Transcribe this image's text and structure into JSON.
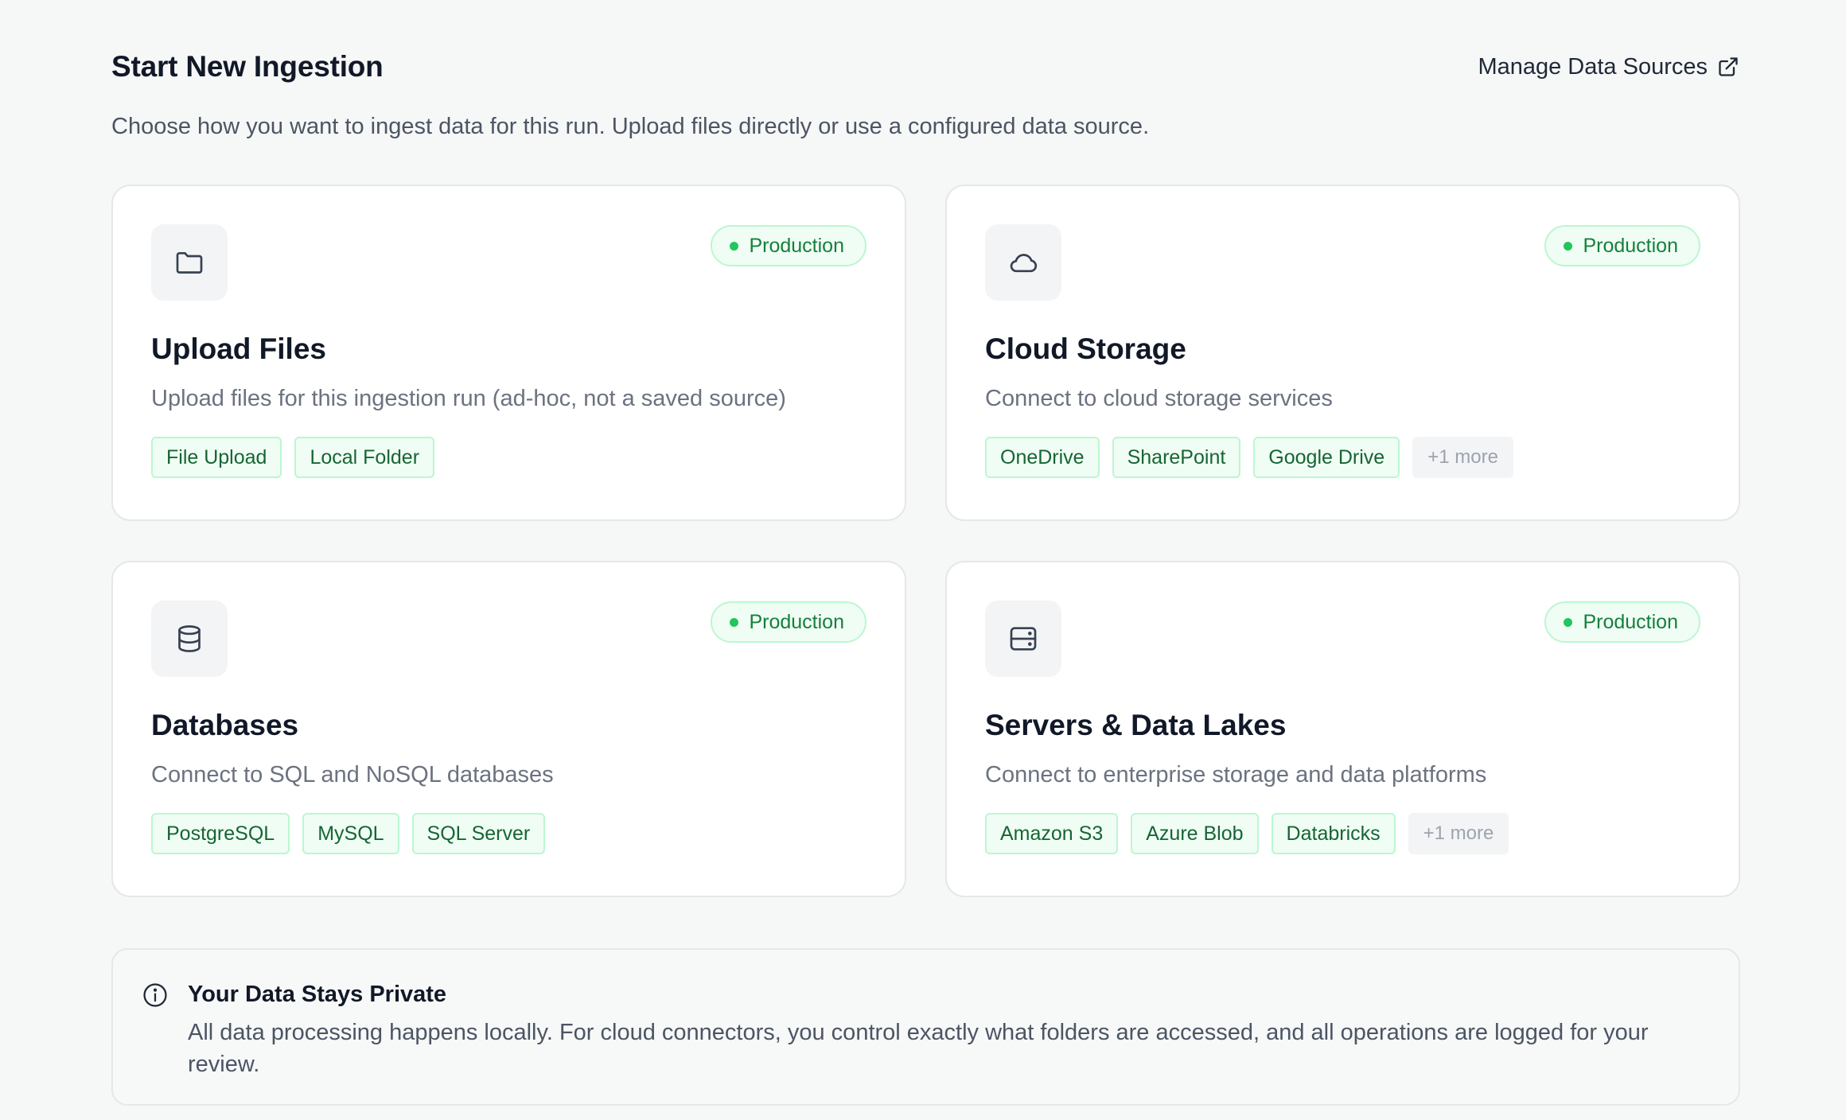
{
  "header": {
    "title": "Start New Ingestion",
    "manage_link": "Manage Data Sources",
    "manage_icon": "external-link-icon"
  },
  "subtitle": "Choose how you want to ingest data for this run. Upload files directly or use a configured data source.",
  "cards": [
    {
      "icon": "folder-icon",
      "badge": "Production",
      "title": "Upload Files",
      "description": "Upload files for this ingestion run (ad-hoc, not a saved source)",
      "tags": [
        "File Upload",
        "Local Folder"
      ],
      "more": ""
    },
    {
      "icon": "cloud-icon",
      "badge": "Production",
      "title": "Cloud Storage",
      "description": "Connect to cloud storage services",
      "tags": [
        "OneDrive",
        "SharePoint",
        "Google Drive"
      ],
      "more": "+1 more"
    },
    {
      "icon": "database-icon",
      "badge": "Production",
      "title": "Databases",
      "description": "Connect to SQL and NoSQL databases",
      "tags": [
        "PostgreSQL",
        "MySQL",
        "SQL Server"
      ],
      "more": ""
    },
    {
      "icon": "server-icon",
      "badge": "Production",
      "title": "Servers & Data Lakes",
      "description": "Connect to enterprise storage and data platforms",
      "tags": [
        "Amazon S3",
        "Azure Blob",
        "Databricks"
      ],
      "more": "+1 more"
    }
  ],
  "privacy": {
    "icon": "info-icon",
    "title": "Your Data Stays Private",
    "body": "All data processing happens locally. For cloud connectors, you control exactly what folders are accessed, and all operations are logged for your review."
  },
  "colors": {
    "accent_green": "#22c55e",
    "badge_text": "#15803d",
    "tag_text": "#166534",
    "background": "#f6f7f7"
  }
}
